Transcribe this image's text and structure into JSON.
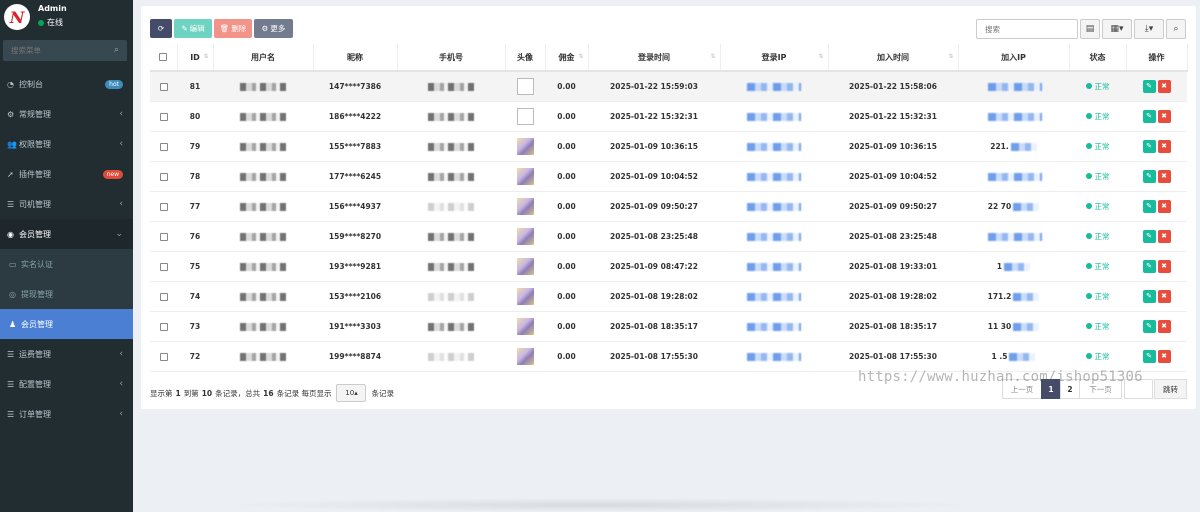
{
  "sidebar": {
    "logo_letter": "N",
    "user": "Admin",
    "status": "在线",
    "search_placeholder": "搜索菜单",
    "items": [
      {
        "icon": "dashboard-icon",
        "glyph": "◔",
        "label": "控制台",
        "badge": "hot"
      },
      {
        "icon": "cogs-icon",
        "glyph": "⚙",
        "label": "常规管理"
      },
      {
        "icon": "users-icon",
        "glyph": "👥",
        "label": "权限管理"
      },
      {
        "icon": "rocket-icon",
        "glyph": "➚",
        "label": "插件管理",
        "badge": "new"
      },
      {
        "icon": "list-icon",
        "glyph": "☰",
        "label": "司机管理"
      },
      {
        "icon": "user-circle-icon",
        "glyph": "◉",
        "label": "会员管理"
      }
    ],
    "sub_items": [
      {
        "icon": "id-card-icon",
        "glyph": "▭",
        "label": "实名认证"
      },
      {
        "icon": "circle-icon",
        "glyph": "◎",
        "label": "提现管理"
      },
      {
        "icon": "user-icon",
        "glyph": "♟",
        "label": "会员管理"
      }
    ],
    "items_after": [
      {
        "icon": "list-icon",
        "glyph": "☰",
        "label": "运费管理"
      },
      {
        "icon": "list-icon",
        "glyph": "☰",
        "label": "配置管理"
      },
      {
        "icon": "list-icon",
        "glyph": "☰",
        "label": "订单管理"
      }
    ]
  },
  "toolbar": {
    "edit_label": "编辑",
    "delete_label": "删除",
    "more_label": "更多",
    "search_placeholder": "搜索"
  },
  "table": {
    "headers": [
      "ID",
      "用户名",
      "昵称",
      "手机号",
      "头像",
      "佣金",
      "登录时间",
      "登录IP",
      "加入时间",
      "加入IP",
      "状态",
      "操作"
    ],
    "rows": [
      {
        "id": "81",
        "nickname": "147****7386",
        "avatar": "broken",
        "commission": "0.00",
        "login_time": "2025-01-22 15:59:03",
        "join_time": "2025-01-22 15:58:06",
        "join_ip": "",
        "status": "正常"
      },
      {
        "id": "80",
        "nickname": "186****4222",
        "avatar": "broken",
        "commission": "0.00",
        "login_time": "2025-01-22 15:32:31",
        "join_time": "2025-01-22 15:32:31",
        "join_ip": "",
        "status": "正常"
      },
      {
        "id": "79",
        "nickname": "155****7883",
        "avatar": "img",
        "commission": "0.00",
        "login_time": "2025-01-09 10:36:15",
        "join_time": "2025-01-09 10:36:15",
        "join_ip": "221.",
        "status": "正常"
      },
      {
        "id": "78",
        "nickname": "177****6245",
        "avatar": "img",
        "commission": "0.00",
        "login_time": "2025-01-09 10:04:52",
        "join_time": "2025-01-09 10:04:52",
        "join_ip": "",
        "status": "正常"
      },
      {
        "id": "77",
        "nickname": "156****4937",
        "avatar": "img",
        "commission": "0.00",
        "login_time": "2025-01-09 09:50:27",
        "join_time": "2025-01-09 09:50:27",
        "join_ip": "22 70",
        "status": "正常"
      },
      {
        "id": "76",
        "nickname": "159****8270",
        "avatar": "img",
        "commission": "0.00",
        "login_time": "2025-01-08 23:25:48",
        "join_time": "2025-01-08 23:25:48",
        "join_ip": "",
        "status": "正常"
      },
      {
        "id": "75",
        "nickname": "193****9281",
        "avatar": "img",
        "commission": "0.00",
        "login_time": "2025-01-09 08:47:22",
        "join_time": "2025-01-08 19:33:01",
        "join_ip": "1",
        "status": "正常"
      },
      {
        "id": "74",
        "nickname": "153****2106",
        "avatar": "img",
        "commission": "0.00",
        "login_time": "2025-01-08 19:28:02",
        "join_time": "2025-01-08 19:28:02",
        "join_ip": "171.2",
        "status": "正常"
      },
      {
        "id": "73",
        "nickname": "191****3303",
        "avatar": "img",
        "commission": "0.00",
        "login_time": "2025-01-08 18:35:17",
        "join_time": "2025-01-08 18:35:17",
        "join_ip": "11 30",
        "status": "正常"
      },
      {
        "id": "72",
        "nickname": "199****8874",
        "avatar": "img",
        "commission": "0.00",
        "login_time": "2025-01-08 17:55:30",
        "join_time": "2025-01-08 17:55:30",
        "join_ip": "1 .5",
        "status": "正常"
      }
    ]
  },
  "pagination": {
    "info_prefix": "显示第",
    "from": "1",
    "info_to": "到第",
    "to": "10",
    "info_total": "条记录，总共",
    "total": "16",
    "info_per": "条记录 每页显示",
    "page_size": "10",
    "info_suffix": "条记录",
    "prev": "上一页",
    "page1": "1",
    "page2": "2",
    "next": "下一页",
    "jump": "跳转"
  },
  "watermark": "https://www.huzhan.com/ishop51306",
  "colors": {
    "sidebar_bg": "#222d32",
    "active_menu": "#4a7fd3",
    "status_green": "#18bc9c",
    "delete_red": "#e74c3c",
    "primary_dark": "#444c69"
  }
}
